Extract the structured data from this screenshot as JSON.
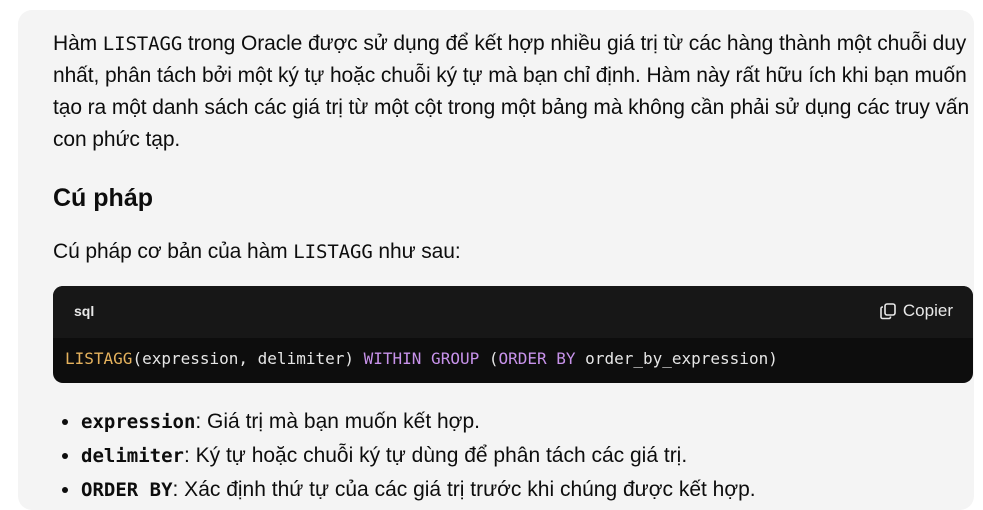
{
  "intro": {
    "t1": "Hàm ",
    "code1": "LISTAGG",
    "t2": " trong Oracle được sử dụng để kết hợp nhiều giá trị từ các hàng thành một chuỗi duy nhất, phân tách bởi một ký tự hoặc chuỗi ký tự mà bạn chỉ định. Hàm này rất hữu ích khi bạn muốn tạo ra một danh sách các giá trị từ một cột trong một bảng mà không cần phải sử dụng các truy vấn con phức tạp."
  },
  "syntax": {
    "heading": "Cú pháp",
    "intro_t1": "Cú pháp cơ bản của hàm ",
    "intro_code": "LISTAGG",
    "intro_t2": " như sau:"
  },
  "codeblock": {
    "language": "sql",
    "copy_label": "Copier",
    "tokens": {
      "fn": "LISTAGG",
      "args": "(expression, delimiter) ",
      "within": "WITHIN GROUP",
      "open": " (",
      "orderby": "ORDER BY",
      "rest": " order_by_expression)"
    }
  },
  "params": [
    {
      "name": "expression",
      "desc": ": Giá trị mà bạn muốn kết hợp."
    },
    {
      "name": "delimiter",
      "desc": ": Ký tự hoặc chuỗi ký tự dùng để phân tách các giá trị."
    },
    {
      "name": "ORDER BY",
      "desc": ": Xác định thứ tự của các giá trị trước khi chúng được kết hợp."
    }
  ]
}
